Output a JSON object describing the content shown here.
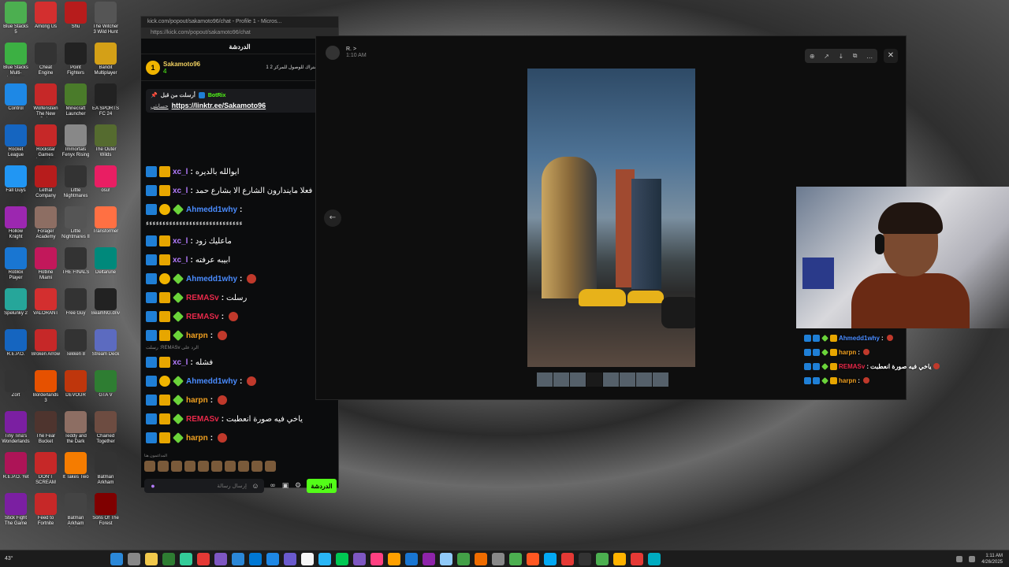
{
  "desktop": {
    "icons": [
      {
        "label": "Blue Stacks 5",
        "color": "#4caf50"
      },
      {
        "label": "Among Us",
        "color": "#d32f2f"
      },
      {
        "label": "Shu",
        "color": "#b71c1c"
      },
      {
        "label": "The Witcher 3 Wild Hunt",
        "color": "#555"
      },
      {
        "label": "Blue Stacks Multi-Instance",
        "color": "#3cb043"
      },
      {
        "label": "Cheat Engine",
        "color": "#333"
      },
      {
        "label": "Point Fighters",
        "color": "#222"
      },
      {
        "label": "Bandit Multiplayer",
        "color": "#d4a017"
      },
      {
        "label": "Control",
        "color": "#1e88e5"
      },
      {
        "label": "Wolfenstein The New Order",
        "color": "#c62828"
      },
      {
        "label": "Minecraft Launcher",
        "color": "#4a7b2a"
      },
      {
        "label": "EA SPORTS FC 24",
        "color": "#222"
      },
      {
        "label": "Rocket League",
        "color": "#1565c0"
      },
      {
        "label": "Rockstar Games Launcher",
        "color": "#c62828"
      },
      {
        "label": "Immortals Fenyx Rising",
        "color": "#888"
      },
      {
        "label": "The Outer Wilds",
        "color": "#556b2f"
      },
      {
        "label": "Fall Guys",
        "color": "#2196f3"
      },
      {
        "label": "Lethal Company",
        "color": "#b71c1c"
      },
      {
        "label": "Little Nightmares",
        "color": "#333"
      },
      {
        "label": "osu!",
        "color": "#e91e63"
      },
      {
        "label": "Hollow Knight",
        "color": "#9c27b0"
      },
      {
        "label": "Forager Academy",
        "color": "#8d6e63"
      },
      {
        "label": "Little Nightmares II",
        "color": "#555"
      },
      {
        "label": "Transformer",
        "color": "#ff7043"
      },
      {
        "label": "Roblox Player",
        "color": "#1976d2"
      },
      {
        "label": "Hotline Miami",
        "color": "#c2185b"
      },
      {
        "label": "THE FINALS",
        "color": "#333"
      },
      {
        "label": "Deltarune",
        "color": "#00897b"
      },
      {
        "label": "Spelunky 2",
        "color": "#26a69a"
      },
      {
        "label": "VALORANT",
        "color": "#d32f2f"
      },
      {
        "label": "Free Guy",
        "color": "#333"
      },
      {
        "label": "BeamNG.drive",
        "color": "#222"
      },
      {
        "label": "R.E.P.O.",
        "color": "#1565c0"
      },
      {
        "label": "Broken Arrow",
        "color": "#c62828"
      },
      {
        "label": "Tekken 8",
        "color": "#333"
      },
      {
        "label": "Stream Deck",
        "color": "#5c6bc0"
      },
      {
        "label": "Zort",
        "color": "#333"
      },
      {
        "label": "Borderlands 3",
        "color": "#e65100"
      },
      {
        "label": "DEVOUR",
        "color": "#bf360c"
      },
      {
        "label": "GTA V",
        "color": "#2e7d32"
      },
      {
        "label": "Tiny Tina's Wonderlands",
        "color": "#7b1fa2"
      },
      {
        "label": "The Fear Bucket",
        "color": "#4e342e"
      },
      {
        "label": "Teddy and the Dark",
        "color": "#8d6e63"
      },
      {
        "label": "Chained Together",
        "color": "#6d4c41"
      },
      {
        "label": "R.E.P.O. Yet",
        "color": "#ad1457"
      },
      {
        "label": "DON'T SCREAM",
        "color": "#c62828"
      },
      {
        "label": "It Takes Two",
        "color": "#f57c00"
      },
      {
        "label": "Batman Arkham",
        "color": "#333"
      },
      {
        "label": "Stick Fight The Game",
        "color": "#7b1fa2"
      },
      {
        "label": "Feed to Fortnite",
        "color": "#c62828"
      },
      {
        "label": "Batman Arkham Asylum",
        "color": "#444"
      },
      {
        "label": "Sons Of The Forest",
        "color": "#7f0000"
      }
    ]
  },
  "chat_window": {
    "titlebar": "kick.com/popout/sakamoto96/chat - Profile 1 - Micros...",
    "url": "https://kick.com/popout/sakamoto96/chat",
    "header": "الدردشة",
    "sub": {
      "badge": "1",
      "name": "Sakamoto96",
      "count": "4",
      "goal": "1 إهداء الاشتراك للوصول للمركز 2"
    },
    "pinned": {
      "label": "أرسلت من قبل",
      "bot": "BotRix",
      "prefix": "حسابتي",
      "link": "https://linktr.ee/Sakamoto96"
    },
    "messages": [
      {
        "kind": "msg",
        "badges": [
          "mod",
          "crown"
        ],
        "user": "xc_l",
        "color": "#b57cff",
        "text": "ايوالله بالديره"
      },
      {
        "kind": "msg",
        "badges": [
          "mod",
          "crown"
        ],
        "user": "xc_l",
        "color": "#b57cff",
        "text": "فعلا مايندارون الشارع الا بشارع حمد"
      },
      {
        "kind": "msg",
        "badges": [
          "mod",
          "sub",
          "vip"
        ],
        "user": "Ahmedd1why",
        "color": "#4a8cff",
        "text": ""
      },
      {
        "kind": "long",
        "text": "ءءءءءءءءءءءءءءءءءءءءءءءءءءءءء"
      },
      {
        "kind": "msg",
        "badges": [
          "mod",
          "crown"
        ],
        "user": "xc_l",
        "color": "#b57cff",
        "text": "ماعليك زود"
      },
      {
        "kind": "msg",
        "badges": [
          "mod",
          "crown"
        ],
        "user": "xc_l",
        "color": "#b57cff",
        "text": "ابيبه عرفته"
      },
      {
        "kind": "msg",
        "badges": [
          "mod",
          "sub",
          "vip"
        ],
        "user": "Ahmedd1why",
        "color": "#4a8cff",
        "text": "",
        "emote": true
      },
      {
        "kind": "msg",
        "badges": [
          "mod",
          "crown",
          "vip"
        ],
        "user": "REMASv",
        "color": "#e8294a",
        "text": "رسلت"
      },
      {
        "kind": "msg",
        "badges": [
          "mod",
          "crown",
          "vip"
        ],
        "user": "REMASv",
        "color": "#e8294a",
        "text": "",
        "emote": true
      },
      {
        "kind": "msg",
        "badges": [
          "mod",
          "crown",
          "vip"
        ],
        "user": "harpn",
        "color": "#f0a020",
        "text": "",
        "emote": true
      },
      {
        "kind": "reply",
        "text": "رسلت :REMASv الرد على"
      },
      {
        "kind": "msg",
        "badges": [
          "mod",
          "crown"
        ],
        "user": "xc_l",
        "color": "#b57cff",
        "text": "فشله"
      },
      {
        "kind": "msg",
        "badges": [
          "mod",
          "sub",
          "vip"
        ],
        "user": "Ahmedd1why",
        "color": "#4a8cff",
        "text": "",
        "emote": true
      },
      {
        "kind": "msg",
        "badges": [
          "mod",
          "crown",
          "vip"
        ],
        "user": "harpn",
        "color": "#f0a020",
        "text": "",
        "emote": true
      },
      {
        "kind": "msg",
        "badges": [
          "mod",
          "crown",
          "vip"
        ],
        "user": "REMASv",
        "color": "#e8294a",
        "text": "ياخي فيه صورة انعطبت"
      },
      {
        "kind": "msg",
        "badges": [
          "mod",
          "crown",
          "vip"
        ],
        "user": "harpn",
        "color": "#f0a020",
        "text": "",
        "emote": true
      }
    ],
    "emote_row_label": "المداعمون هنا",
    "input_placeholder": "إرسال رسالة",
    "send_label": "الدردشة"
  },
  "viewer": {
    "user": "R. >",
    "time": "1:10 AM"
  },
  "overlay_chat": [
    {
      "user": "Ahmedd1why",
      "color": "#4a8cff",
      "text": ""
    },
    {
      "user": "harpn",
      "color": "#f0a020",
      "text": ""
    },
    {
      "user": "REMASv",
      "color": "#e8294a",
      "text": "ياخي فيه صورة انعطبت"
    },
    {
      "user": "harpn",
      "color": "#f0a020",
      "text": ""
    }
  ],
  "taskbar": {
    "weather": "43°",
    "time": "1:11 AM",
    "date": "4/26/2025"
  }
}
